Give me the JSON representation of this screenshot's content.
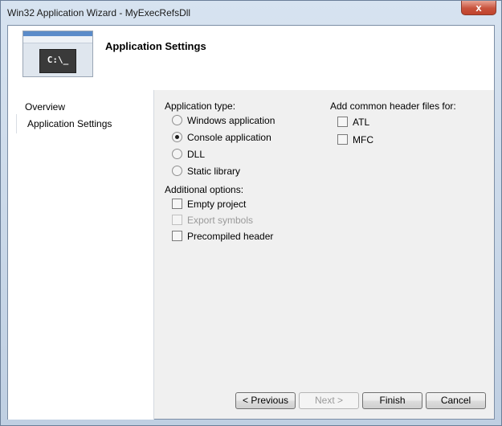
{
  "window": {
    "title": "Win32 Application Wizard - MyExecRefsDll",
    "close_glyph": "x"
  },
  "header": {
    "title": "Application Settings",
    "console_prompt": "C:\\_"
  },
  "sidebar": {
    "items": [
      {
        "label": "Overview"
      },
      {
        "label": "Application Settings",
        "active": true
      }
    ]
  },
  "app_type": {
    "label": "Application type:",
    "options": [
      {
        "label": "Windows application",
        "checked": false
      },
      {
        "label": "Console application",
        "checked": true
      },
      {
        "label": "DLL",
        "checked": false
      },
      {
        "label": "Static library",
        "checked": false
      }
    ]
  },
  "additional": {
    "label": "Additional options:",
    "options": [
      {
        "label": "Empty project",
        "checked": false,
        "enabled": true
      },
      {
        "label": "Export symbols",
        "checked": false,
        "enabled": false
      },
      {
        "label": "Precompiled header",
        "checked": false,
        "enabled": true
      }
    ]
  },
  "headers": {
    "label": "Add common header files for:",
    "options": [
      {
        "label": "ATL",
        "checked": false
      },
      {
        "label": "MFC",
        "checked": false
      }
    ]
  },
  "buttons": {
    "previous": "< Previous",
    "next": "Next >",
    "finish": "Finish",
    "cancel": "Cancel"
  }
}
